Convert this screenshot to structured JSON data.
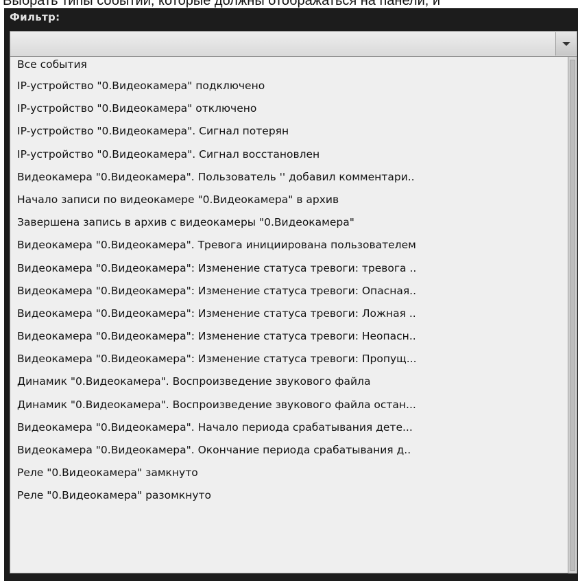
{
  "header_text": "Выбрать типы событий, которые должны отображаться на панели, и",
  "filter": {
    "label": "Фильтр:",
    "value": ""
  },
  "items": [
    "Все события",
    "IP-устройство \"0.Видеокамера\" подключено",
    "IP-устройство \"0.Видеокамера\" отключено",
    "IP-устройство \"0.Видеокамера\". Сигнал потерян",
    "IP-устройство \"0.Видеокамера\". Сигнал восстановлен",
    "Видеокамера \"0.Видеокамера\". Пользователь '' добавил комментари..",
    "Начало записи по видеокамере \"0.Видеокамера\" в архив",
    "Завершена запись в архив  с видеокамеры \"0.Видеокамера\"",
    "Видеокамера \"0.Видеокамера\". Тревога инициирована пользователем",
    "Видеокамера \"0.Видеокамера\": Изменение статуса тревоги: тревога ..",
    "Видеокамера \"0.Видеокамера\": Изменение статуса тревоги: Опасная..",
    "Видеокамера \"0.Видеокамера\": Изменение статуса тревоги: Ложная ..",
    "Видеокамера \"0.Видеокамера\": Изменение статуса тревоги: Неопасн..",
    "Видеокамера \"0.Видеокамера\": Изменение статуса тревоги: Пропущ...",
    "Динамик \"0.Видеокамера\". Воспроизведение звукового файла",
    "Динамик \"0.Видеокамера\". Воспроизведение звукового файла остан...",
    "Видеокамера \"0.Видеокамера\". Начало периода срабатывания дете...",
    "Видеокамера \"0.Видеокамера\". Окончание периода срабатывания д..",
    "Реле \"0.Видеокамера\" замкнуто",
    "Реле \"0.Видеокамера\" разомкнуто"
  ]
}
